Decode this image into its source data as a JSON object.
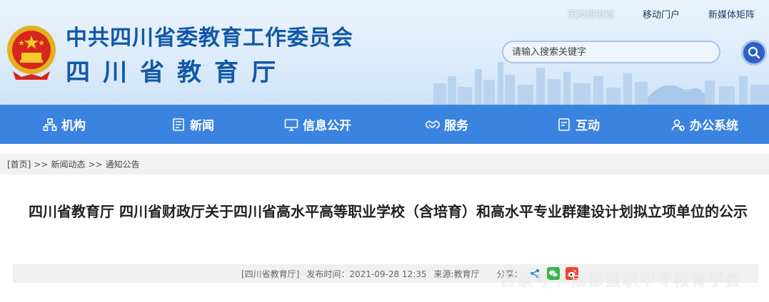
{
  "header": {
    "org_title": "中共四川省委教育工作委员会",
    "org_subtitle": "四川省教育厅",
    "top_links": [
      "无障碍浏览",
      "移动门户",
      "新媒体矩阵"
    ],
    "search_placeholder": "请输入搜索关键字",
    "emblem_icon": "national-emblem-icon",
    "search_icon": "search-icon"
  },
  "nav": {
    "items": [
      {
        "label": "机构",
        "icon": "org-chart-icon"
      },
      {
        "label": "新闻",
        "icon": "news-icon"
      },
      {
        "label": "信息公开",
        "icon": "monitor-icon"
      },
      {
        "label": "服务",
        "icon": "handshake-icon"
      },
      {
        "label": "互动",
        "icon": "chat-icon"
      },
      {
        "label": "办公系统",
        "icon": "users-icon"
      }
    ]
  },
  "breadcrumb": {
    "home": "[首页]",
    "separator": ">>",
    "level1": "新闻动态",
    "level2": "通知公告"
  },
  "article": {
    "title": "四川省教育厅 四川省财政厅关于四川省高水平高等职业学校（含培育）和高水平专业群建设计划拟立项单位的公示",
    "source_tag": "[四川省教育厅]",
    "published": "发布时间：2021-09-28 12:35",
    "from": "来源:教育厅",
    "share_label": "分享：",
    "share_icons": [
      "share-icon",
      "wechat-icon",
      "weibo-icon"
    ]
  },
  "watermark": "百家号 / 成都重职中专教育学会",
  "colors": {
    "brand_blue": "#1258a8",
    "nav_blue": "#3b83e0",
    "search_button": "#2f5fc8"
  }
}
